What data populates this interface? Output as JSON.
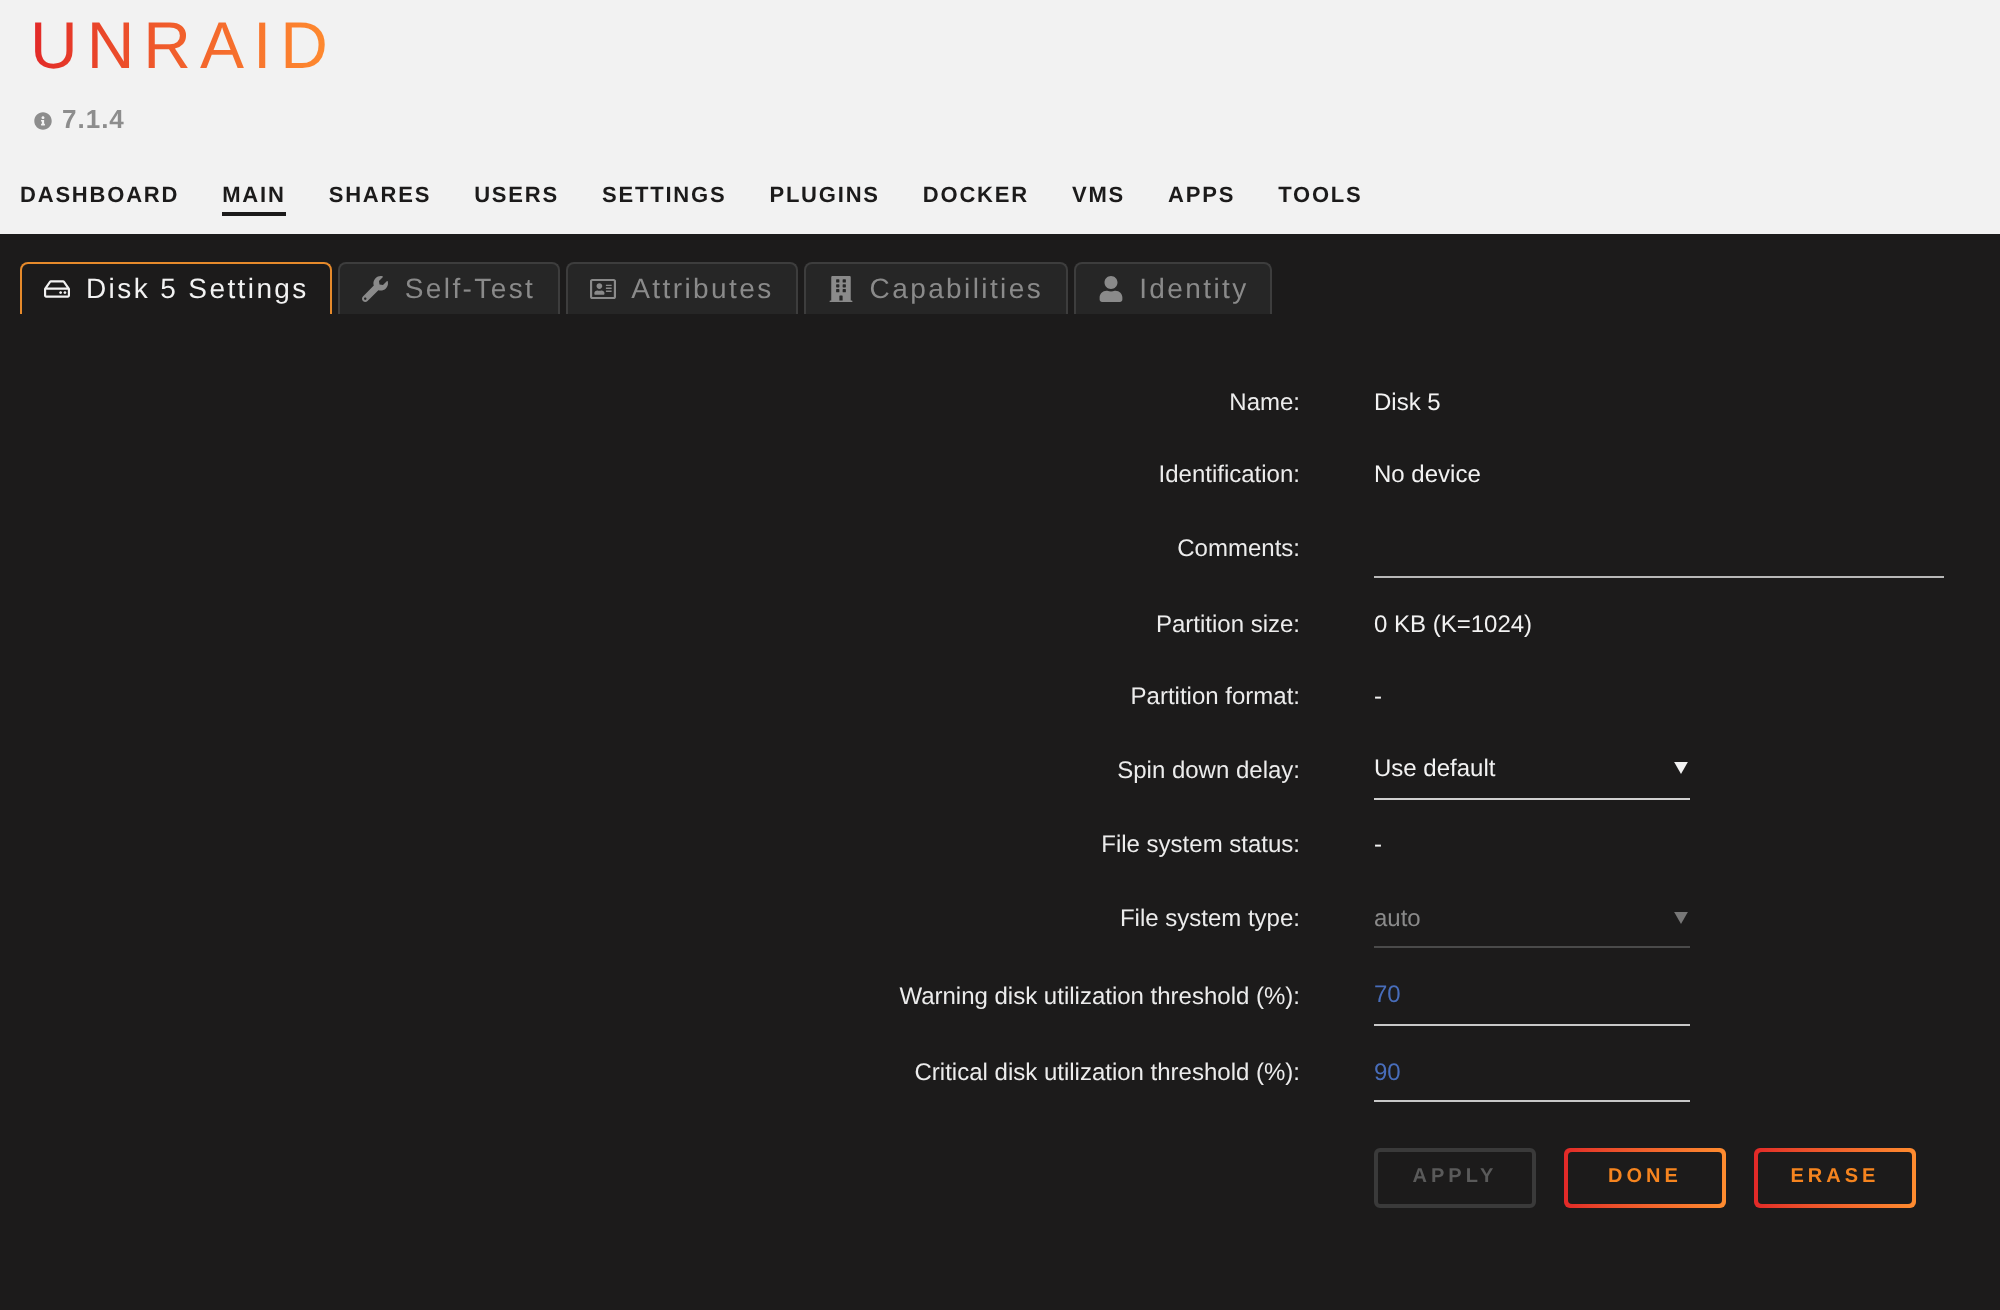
{
  "header": {
    "logo": "UNRAID",
    "version": "7.1.4"
  },
  "nav": [
    {
      "label": "DASHBOARD",
      "selected": false
    },
    {
      "label": "MAIN",
      "selected": true
    },
    {
      "label": "SHARES",
      "selected": false
    },
    {
      "label": "USERS",
      "selected": false
    },
    {
      "label": "SETTINGS",
      "selected": false
    },
    {
      "label": "PLUGINS",
      "selected": false
    },
    {
      "label": "DOCKER",
      "selected": false
    },
    {
      "label": "VMS",
      "selected": false
    },
    {
      "label": "APPS",
      "selected": false
    },
    {
      "label": "TOOLS",
      "selected": false
    }
  ],
  "tabs": [
    {
      "label": "Disk 5 Settings",
      "selected": true
    },
    {
      "label": "Self-Test",
      "selected": false
    },
    {
      "label": "Attributes",
      "selected": false
    },
    {
      "label": "Capabilities",
      "selected": false
    },
    {
      "label": "Identity",
      "selected": false
    }
  ],
  "form": {
    "rows": [
      {
        "label": "Name:",
        "kind": "text",
        "value": "Disk 5"
      },
      {
        "label": "Identification:",
        "kind": "text",
        "value": "No device"
      },
      {
        "label": "Comments:",
        "kind": "text_input"
      },
      {
        "label": "Partition size:",
        "kind": "text",
        "value": "0 KB (K=1024)"
      },
      {
        "label": "Partition format:",
        "kind": "text",
        "value": "-"
      },
      {
        "label": "Spin down delay:",
        "kind": "select",
        "value": "Use default",
        "disabled": false
      },
      {
        "label": "File system status:",
        "kind": "text",
        "value": "-"
      },
      {
        "label": "File system type:",
        "kind": "select",
        "value": "auto",
        "disabled": true
      },
      {
        "label": "Warning disk utilization threshold (%):",
        "kind": "number_input",
        "value": "70"
      },
      {
        "label": "Critical disk utilization threshold (%):",
        "kind": "number_input",
        "value": "90"
      }
    ]
  },
  "buttons": [
    {
      "label": "APPLY",
      "disabled": true
    },
    {
      "label": "DONE",
      "disabled": false
    },
    {
      "label": "ERASE",
      "disabled": false
    }
  ]
}
